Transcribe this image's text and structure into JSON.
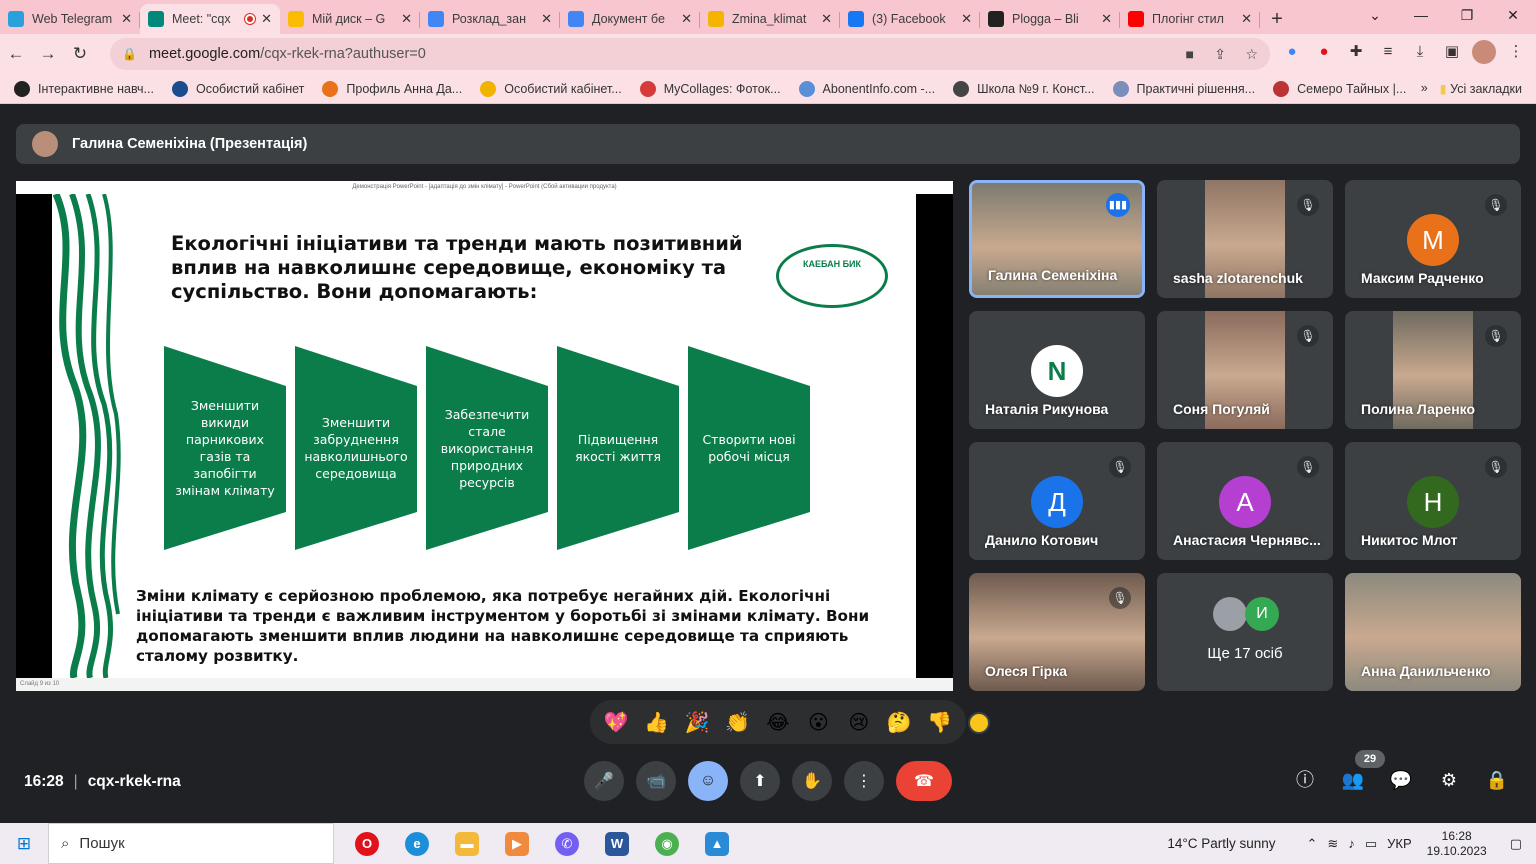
{
  "tabs": [
    {
      "title": "Web Telegram",
      "color": "#2aa1da",
      "active": false
    },
    {
      "title": "Meet: \"cqx",
      "color": "#00897b",
      "active": true
    },
    {
      "title": "Мій диск – G",
      "color": "#fbbc04",
      "active": false
    },
    {
      "title": "Розклад_зан",
      "color": "#4285f4",
      "active": false
    },
    {
      "title": "Документ бе",
      "color": "#4285f4",
      "active": false
    },
    {
      "title": "Zmina_klimat",
      "color": "#f4b400",
      "active": false
    },
    {
      "title": "(3) Facebook",
      "color": "#1877f2",
      "active": false
    },
    {
      "title": "Plogga – Bli",
      "color": "#222222",
      "active": false
    },
    {
      "title": "Плогінг стил",
      "color": "#ff0000",
      "active": false
    }
  ],
  "window": {
    "new_tab": "+",
    "dropdown": "⌄",
    "minimize": "—",
    "restore": "❐",
    "close": "✕"
  },
  "nav": {
    "back": "←",
    "forward": "→",
    "reload": "↻"
  },
  "url": {
    "host": "meet.google.com",
    "path": "/cqx-rkek-rna?authuser=0"
  },
  "bookmarks": [
    {
      "label": "Інтерактивне навч...",
      "color": "#222"
    },
    {
      "label": "Особистий кабінет",
      "color": "#1a4d8f"
    },
    {
      "label": "Профиль Анна Да...",
      "color": "#e8711a"
    },
    {
      "label": "Особистий кабінет...",
      "color": "#f2b300"
    },
    {
      "label": "MyCollages: Фоток...",
      "color": "#d63a3a"
    },
    {
      "label": "AbonentInfo.com -...",
      "color": "#5a8fd6"
    },
    {
      "label": "Школа №9 г. Конст...",
      "color": "#444"
    },
    {
      "label": "Практичні рішення...",
      "color": "#7b8dbb"
    },
    {
      "label": "Семеро Тайных |...",
      "color": "#b33"
    }
  ],
  "bookmarks_more": "»",
  "bookmarks_all": "Усі закладки",
  "presenter_bar": "Галина Семеніхіна (Презентація)",
  "ppt": {
    "title": "Демонстрація PowerPoint - [адаптація до змін клімату] - PowerPoint (Сбой активации продукта)",
    "status": "Слайд 9 из 10"
  },
  "slide": {
    "title": "Екологічні ініціативи та тренди мають позитивний вплив на навколишнє середовище, економіку та суспільство. Вони допомагають:",
    "logo": "КАЕБАН БИК",
    "items": [
      "Зменшити викиди парникових газів та запобігти змінам клімату",
      "Зменшити забруднення навколишнього середовища",
      "Забезпечити стале використання природних ресурсів",
      "Підвищення якості життя",
      "Створити нові робочі місця"
    ],
    "body": "Зміни клімату є серйозною проблемою, яка потребує негайних дій. Екологічні ініціативи та тренди є важливим інструментом у боротьбі зі змінами клімату. Вони допомагають зменшити вплив людини на навколишнє середовище та сприяють сталому розвитку.",
    "green": "#0b7d4b"
  },
  "participants": [
    {
      "name": "Галина Семеніхіна",
      "type": "photo",
      "color": "#7c7b6f",
      "speaking": true
    },
    {
      "name": "sasha zlotarenchuk",
      "type": "photo",
      "color": "#8f7565",
      "muted": true
    },
    {
      "name": "Максим Радченко",
      "type": "letter",
      "letter": "М",
      "color": "#e8711a",
      "muted": true
    },
    {
      "name": "Наталія Рикунова",
      "type": "letter",
      "letter": "N",
      "color": "#ffffff",
      "muted": false
    },
    {
      "name": "Соня Погуляй",
      "type": "photo",
      "color": "#8a6b5d",
      "muted": true
    },
    {
      "name": "Полина Ларенко",
      "type": "photo",
      "color": "#6f6a5f",
      "muted": true
    },
    {
      "name": "Данило Котович",
      "type": "letter",
      "letter": "Д",
      "color": "#1a73e8",
      "muted": true
    },
    {
      "name": "Анастасия Чернявс...",
      "type": "letter",
      "letter": "А",
      "color": "#b43fd1",
      "muted": true
    },
    {
      "name": "Никитос Млот",
      "type": "letter",
      "letter": "Н",
      "color": "#33691e",
      "muted": true
    },
    {
      "name": "Олеся Гірка",
      "type": "photo",
      "color": "#6e5a4f",
      "muted": true
    },
    {
      "name": "Ще 17 осіб",
      "type": "more",
      "letter": "И",
      "color": "#34a853"
    },
    {
      "name": "Анна Данильченко",
      "type": "photo",
      "color": "#8c8a7e",
      "muted": false
    }
  ],
  "reactions": [
    "💖",
    "👍",
    "🎉",
    "👏",
    "😂",
    "😮",
    "😢",
    "🤔",
    "👎"
  ],
  "meeting": {
    "time": "16:28",
    "divider": "|",
    "code": "cqx-rkek-rna"
  },
  "controls": {
    "mic": "🎤",
    "camera": "📹",
    "emoji": "☺",
    "present": "⬆",
    "hand": "✋",
    "more": "⋮",
    "end": "☎"
  },
  "right_controls": {
    "info": "ⓘ",
    "people": "👥",
    "chat": "💬",
    "activities": "⚙",
    "lock": "🔒"
  },
  "people_count": "29",
  "taskbar": {
    "search": "Пошук",
    "weather": "14°C  Partly sunny",
    "lang": "УКР",
    "time": "16:28",
    "date": "19.10.2023",
    "taskbar_icons": [
      "⊞",
      "⌕",
      "☁",
      "🔔"
    ]
  }
}
